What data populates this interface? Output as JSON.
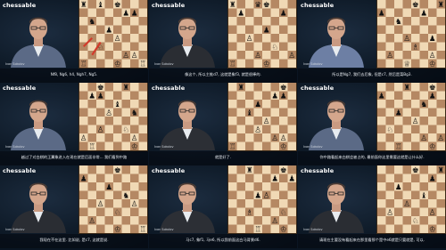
{
  "brand": "chessable",
  "presenter_name": "Ivan Sokolov",
  "colors": {
    "background": "#0a1522",
    "light_square": "#f0d9b5",
    "dark_square": "#b58863",
    "arrow": "#d23a2a"
  },
  "tiles": [
    {
      "subtitle": "Nf8, Ng6, h4, Ngh7, Ng5."
    },
    {
      "subtitle": "像这个, 所以主推d7, 这就是象f3, 就是很棒的."
    },
    {
      "subtitle": "所以是Ng7, 我们去后象, 但是c7, 然后是菜Bg3."
    },
    {
      "subtitle": "越过了对白棋的王翼象进入在现在就是后面非常... 我们看到中路"
    },
    {
      "subtitle": "就是好了."
    },
    {
      "subtitle": "你中路看起来白棋会被占的, 最前面你这里需要这就是让什么好."
    },
    {
      "subtitle": "我现在不在这里. 比如说, 是c7, 这就是说."
    },
    {
      "subtitle": "马c7, 象f1, 马e6, 所以我前面这白马背景d6."
    },
    {
      "subtitle": "请现在主要没有看起来在那里看那个是中e6就是只要就是, 可以."
    }
  ]
}
